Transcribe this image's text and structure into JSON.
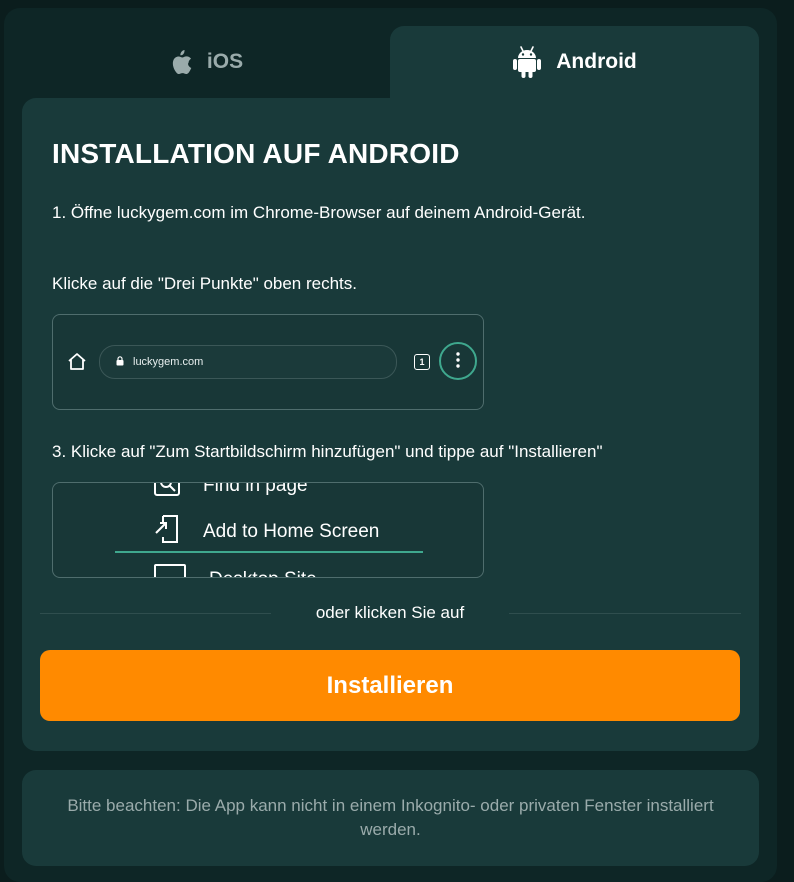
{
  "tabs": {
    "ios": {
      "label": "iOS",
      "icon": "apple-icon"
    },
    "android": {
      "label": "Android",
      "icon": "android-icon",
      "active": true
    }
  },
  "panel": {
    "title": "INSTALLATION AUF ANDROID",
    "step1": "1. Öffne luckygem.com im Chrome-Browser auf deinem Android-Gerät.",
    "step2": "Klicke auf die \"Drei Punkte\" oben rechts.",
    "step3": "3. Klicke auf \"Zum Startbildschirm hinzufügen\" und tippe auf \"Installieren\""
  },
  "browser_mock": {
    "url": "luckygem.com",
    "tab_count": "1",
    "icons": [
      "home-icon",
      "lock-icon",
      "tabs-icon",
      "three-dots-icon"
    ]
  },
  "menu_mock": {
    "items": [
      {
        "label": "Find in page",
        "icon": "find-in-page-icon"
      },
      {
        "label": "Add to Home Screen",
        "icon": "add-to-home-screen-icon"
      },
      {
        "label": "Desktop Site",
        "icon": "desktop-site-icon"
      }
    ]
  },
  "divider_text": "oder klicken Sie auf",
  "install_button": "Installieren",
  "notice": "Bitte beachten: Die App kann nicht in einem Inkognito- oder privaten Fenster installiert werden.",
  "colors": {
    "background": "#0b1d1d",
    "panel": "#193a3a",
    "accent": "#ff8a00",
    "highlight": "#3fa88e",
    "muted_text": "#9aabab"
  }
}
